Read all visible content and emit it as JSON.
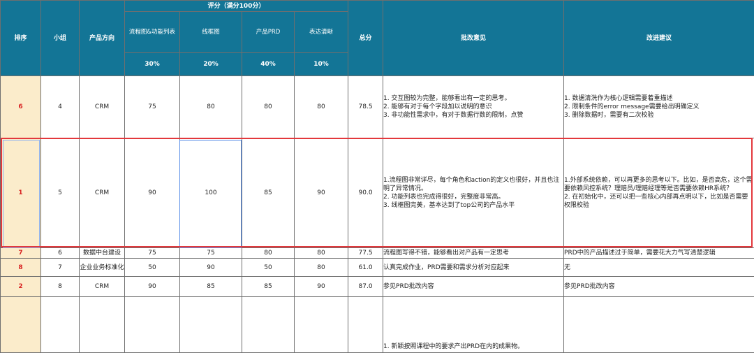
{
  "colors": {
    "header_bg": "#137596",
    "rank_bg": "#fbeccb",
    "rank_text": "#d82020",
    "selection_row_border": "#e3383c",
    "selection_cell_border": "#5b8fe8"
  },
  "header": {
    "rank": "排序",
    "group": "小组",
    "direction": "产品方向",
    "score_group": "评分（满分100分）",
    "crit1": "流程图&功能列表",
    "crit2": "线框图",
    "crit3": "产品PRD",
    "crit4": "表达清晰",
    "w1": "30%",
    "w2": "20%",
    "w3": "40%",
    "w4": "10%",
    "total": "总分",
    "comments": "批改意见",
    "suggestions": "改进建议"
  },
  "rows": [
    {
      "rank": "6",
      "group": "4",
      "direction": "CRM",
      "s1": "75",
      "s2": "80",
      "s3": "80",
      "s4": "80",
      "total": "78.5",
      "comments": "1. 交互图较为完整，能够看出有一定的思考。\n2. 能够有对于每个字段加以说明的意识\n3. 非功能性需求中，有对于数据行数的限制，点赞",
      "suggestions": "1. 数据清洗作为核心逻辑需要着重描述\n2. 限制条件的error message需要给出明确定义\n3. 删除数据时，需要有二次校验"
    },
    {
      "rank": "1",
      "group": "5",
      "direction": "CRM",
      "s1": "90",
      "s2": "100",
      "s3": "85",
      "s4": "90",
      "total": "90.0",
      "comments": "1.流程图非常详尽，每个角色和action的定义也很好，并且也注明了异常情况。\n2. 功能列表也完成得很好，完整度非常高。\n3. 线框图完美，基本达到了top公司的产品水平",
      "suggestions": "1.外部系统依赖，可以再更多的思考以下。比如，是否高危，这个需要依赖风控系统？理赔员/理赔经理等是否需要依赖HR系统？\n2. 在初始化中，还可以把一些核心内部再点明以下，比如是否需要权限校验"
    },
    {
      "rank": "7",
      "group": "6",
      "direction": "数据中台建设",
      "s1": "75",
      "s2": "75",
      "s3": "80",
      "s4": "80",
      "total": "77.5",
      "comments": "流程图写得不错，能够看出对产品有一定思考",
      "suggestions": "PRD中的产品描述过于简单，需要花大力气写清楚逻辑"
    },
    {
      "rank": "8",
      "group": "7",
      "direction": "企业业务标准化",
      "s1": "50",
      "s2": "90",
      "s3": "50",
      "s4": "80",
      "total": "61.0",
      "comments": "认真完成作业，PRD需要和需求分析对应起来",
      "suggestions": "无"
    },
    {
      "rank": "2",
      "group": "8",
      "direction": "CRM",
      "s1": "90",
      "s2": "85",
      "s3": "85",
      "s4": "90",
      "total": "87.0",
      "comments": "参见PRD批改内容",
      "suggestions": "参见PRD批改内容"
    },
    {
      "rank": "",
      "group": "",
      "direction": "",
      "s1": "",
      "s2": "",
      "s3": "",
      "s4": "",
      "total": "",
      "comments": "1. 新颖按照课程中的要求产出PRD在内的成果物。",
      "suggestions": ""
    }
  ]
}
